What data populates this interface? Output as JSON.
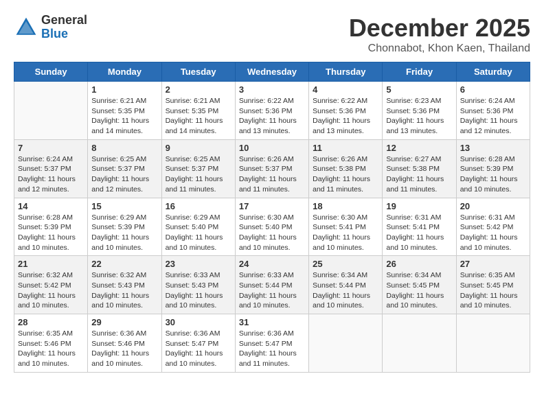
{
  "logo": {
    "general": "General",
    "blue": "Blue"
  },
  "title": "December 2025",
  "location": "Chonnabot, Khon Kaen, Thailand",
  "days_of_week": [
    "Sunday",
    "Monday",
    "Tuesday",
    "Wednesday",
    "Thursday",
    "Friday",
    "Saturday"
  ],
  "weeks": [
    [
      {
        "day": "",
        "info": ""
      },
      {
        "day": "1",
        "info": "Sunrise: 6:21 AM\nSunset: 5:35 PM\nDaylight: 11 hours\nand 14 minutes."
      },
      {
        "day": "2",
        "info": "Sunrise: 6:21 AM\nSunset: 5:35 PM\nDaylight: 11 hours\nand 14 minutes."
      },
      {
        "day": "3",
        "info": "Sunrise: 6:22 AM\nSunset: 5:36 PM\nDaylight: 11 hours\nand 13 minutes."
      },
      {
        "day": "4",
        "info": "Sunrise: 6:22 AM\nSunset: 5:36 PM\nDaylight: 11 hours\nand 13 minutes."
      },
      {
        "day": "5",
        "info": "Sunrise: 6:23 AM\nSunset: 5:36 PM\nDaylight: 11 hours\nand 13 minutes."
      },
      {
        "day": "6",
        "info": "Sunrise: 6:24 AM\nSunset: 5:36 PM\nDaylight: 11 hours\nand 12 minutes."
      }
    ],
    [
      {
        "day": "7",
        "info": "Sunrise: 6:24 AM\nSunset: 5:37 PM\nDaylight: 11 hours\nand 12 minutes."
      },
      {
        "day": "8",
        "info": "Sunrise: 6:25 AM\nSunset: 5:37 PM\nDaylight: 11 hours\nand 12 minutes."
      },
      {
        "day": "9",
        "info": "Sunrise: 6:25 AM\nSunset: 5:37 PM\nDaylight: 11 hours\nand 11 minutes."
      },
      {
        "day": "10",
        "info": "Sunrise: 6:26 AM\nSunset: 5:37 PM\nDaylight: 11 hours\nand 11 minutes."
      },
      {
        "day": "11",
        "info": "Sunrise: 6:26 AM\nSunset: 5:38 PM\nDaylight: 11 hours\nand 11 minutes."
      },
      {
        "day": "12",
        "info": "Sunrise: 6:27 AM\nSunset: 5:38 PM\nDaylight: 11 hours\nand 11 minutes."
      },
      {
        "day": "13",
        "info": "Sunrise: 6:28 AM\nSunset: 5:39 PM\nDaylight: 11 hours\nand 10 minutes."
      }
    ],
    [
      {
        "day": "14",
        "info": "Sunrise: 6:28 AM\nSunset: 5:39 PM\nDaylight: 11 hours\nand 10 minutes."
      },
      {
        "day": "15",
        "info": "Sunrise: 6:29 AM\nSunset: 5:39 PM\nDaylight: 11 hours\nand 10 minutes."
      },
      {
        "day": "16",
        "info": "Sunrise: 6:29 AM\nSunset: 5:40 PM\nDaylight: 11 hours\nand 10 minutes."
      },
      {
        "day": "17",
        "info": "Sunrise: 6:30 AM\nSunset: 5:40 PM\nDaylight: 11 hours\nand 10 minutes."
      },
      {
        "day": "18",
        "info": "Sunrise: 6:30 AM\nSunset: 5:41 PM\nDaylight: 11 hours\nand 10 minutes."
      },
      {
        "day": "19",
        "info": "Sunrise: 6:31 AM\nSunset: 5:41 PM\nDaylight: 11 hours\nand 10 minutes."
      },
      {
        "day": "20",
        "info": "Sunrise: 6:31 AM\nSunset: 5:42 PM\nDaylight: 11 hours\nand 10 minutes."
      }
    ],
    [
      {
        "day": "21",
        "info": "Sunrise: 6:32 AM\nSunset: 5:42 PM\nDaylight: 11 hours\nand 10 minutes."
      },
      {
        "day": "22",
        "info": "Sunrise: 6:32 AM\nSunset: 5:43 PM\nDaylight: 11 hours\nand 10 minutes."
      },
      {
        "day": "23",
        "info": "Sunrise: 6:33 AM\nSunset: 5:43 PM\nDaylight: 11 hours\nand 10 minutes."
      },
      {
        "day": "24",
        "info": "Sunrise: 6:33 AM\nSunset: 5:44 PM\nDaylight: 11 hours\nand 10 minutes."
      },
      {
        "day": "25",
        "info": "Sunrise: 6:34 AM\nSunset: 5:44 PM\nDaylight: 11 hours\nand 10 minutes."
      },
      {
        "day": "26",
        "info": "Sunrise: 6:34 AM\nSunset: 5:45 PM\nDaylight: 11 hours\nand 10 minutes."
      },
      {
        "day": "27",
        "info": "Sunrise: 6:35 AM\nSunset: 5:45 PM\nDaylight: 11 hours\nand 10 minutes."
      }
    ],
    [
      {
        "day": "28",
        "info": "Sunrise: 6:35 AM\nSunset: 5:46 PM\nDaylight: 11 hours\nand 10 minutes."
      },
      {
        "day": "29",
        "info": "Sunrise: 6:36 AM\nSunset: 5:46 PM\nDaylight: 11 hours\nand 10 minutes."
      },
      {
        "day": "30",
        "info": "Sunrise: 6:36 AM\nSunset: 5:47 PM\nDaylight: 11 hours\nand 10 minutes."
      },
      {
        "day": "31",
        "info": "Sunrise: 6:36 AM\nSunset: 5:47 PM\nDaylight: 11 hours\nand 11 minutes."
      },
      {
        "day": "",
        "info": ""
      },
      {
        "day": "",
        "info": ""
      },
      {
        "day": "",
        "info": ""
      }
    ]
  ]
}
